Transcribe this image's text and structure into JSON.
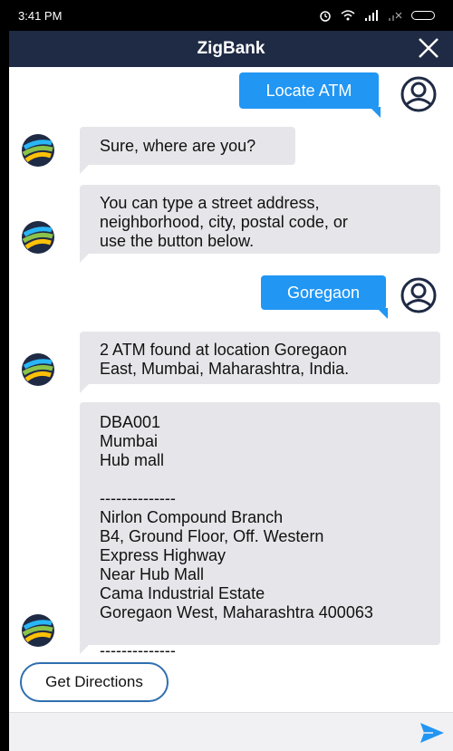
{
  "status_bar": {
    "time": "3:41 PM",
    "icons": [
      "alarm-icon",
      "wifi-icon",
      "signal-icon",
      "signal-off-icon",
      "battery-icon"
    ]
  },
  "header": {
    "title": "ZigBank",
    "close_icon": "close-icon"
  },
  "messages": [
    {
      "from": "user",
      "text": "Locate ATM"
    },
    {
      "from": "bot",
      "text": "Sure, where are you?"
    },
    {
      "from": "bot",
      "lines": [
        "You can type a street address,",
        "neighborhood, city, postal code, or",
        "use the button below."
      ]
    },
    {
      "from": "user",
      "text": "Goregaon"
    },
    {
      "from": "bot",
      "lines": [
        "2 ATM found at location Goregaon",
        "East, Mumbai, Maharashtra, India."
      ]
    },
    {
      "from": "bot",
      "lines": [
        "DBA001",
        "Mumbai",
        "Hub mall",
        "",
        "--------------",
        "Nirlon Compound Branch",
        "B4, Ground Floor, Off. Western",
        "Express Highway",
        "Near Hub Mall",
        "Cama Industrial Estate",
        "Goregaon West, Maharashtra 400063",
        "",
        "--------------"
      ]
    }
  ],
  "quick_reply": {
    "label": "Get Directions"
  },
  "input": {
    "value": "",
    "placeholder": ""
  },
  "colors": {
    "header_bg": "#1f2a44",
    "user_bubble": "#2196f3",
    "bot_bubble": "#e6e6ea",
    "send_icon": "#2196f3",
    "quick_reply_border": "#2f6fb0"
  }
}
